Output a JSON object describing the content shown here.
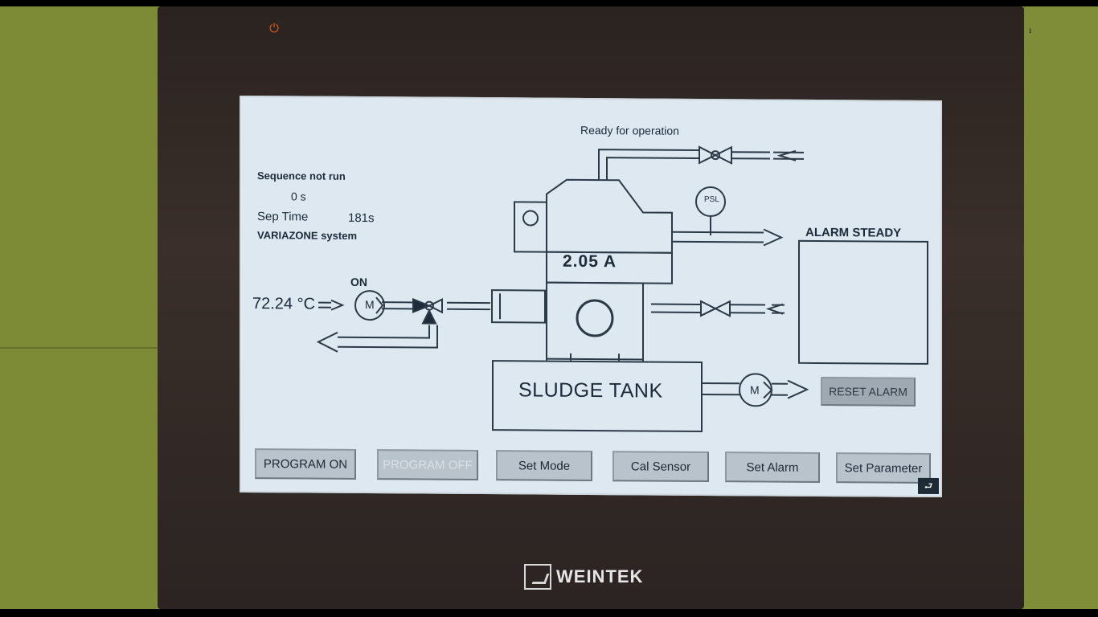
{
  "device": {
    "brand": "WEINTEK",
    "power_icon": "power-icon"
  },
  "hmi": {
    "status": "Ready for operation",
    "sequence_status": "Sequence not run",
    "sequence_time": "0 s",
    "sep_time_label": "Sep Time",
    "sep_time_value": "181s",
    "system_label": "VARIAZONE system",
    "pump_state": "ON",
    "temperature": "72.24 °C",
    "current": "2.05   A",
    "alarm_title": "ALARM STEADY",
    "tank_label": "SLUDGE TANK",
    "psl_label": "PSL",
    "motor_label": "M",
    "reset_button": "RESET ALARM"
  },
  "toolbar": {
    "program_on": "PROGRAM ON",
    "program_off": "PROGRAM OFF",
    "set_mode": "Set Mode",
    "cal_sensor": "Cal Sensor",
    "set_alarm": "Set Alarm",
    "set_parameter": "Set Parameter"
  },
  "icons": {
    "corner": "back-arrow-icon"
  }
}
